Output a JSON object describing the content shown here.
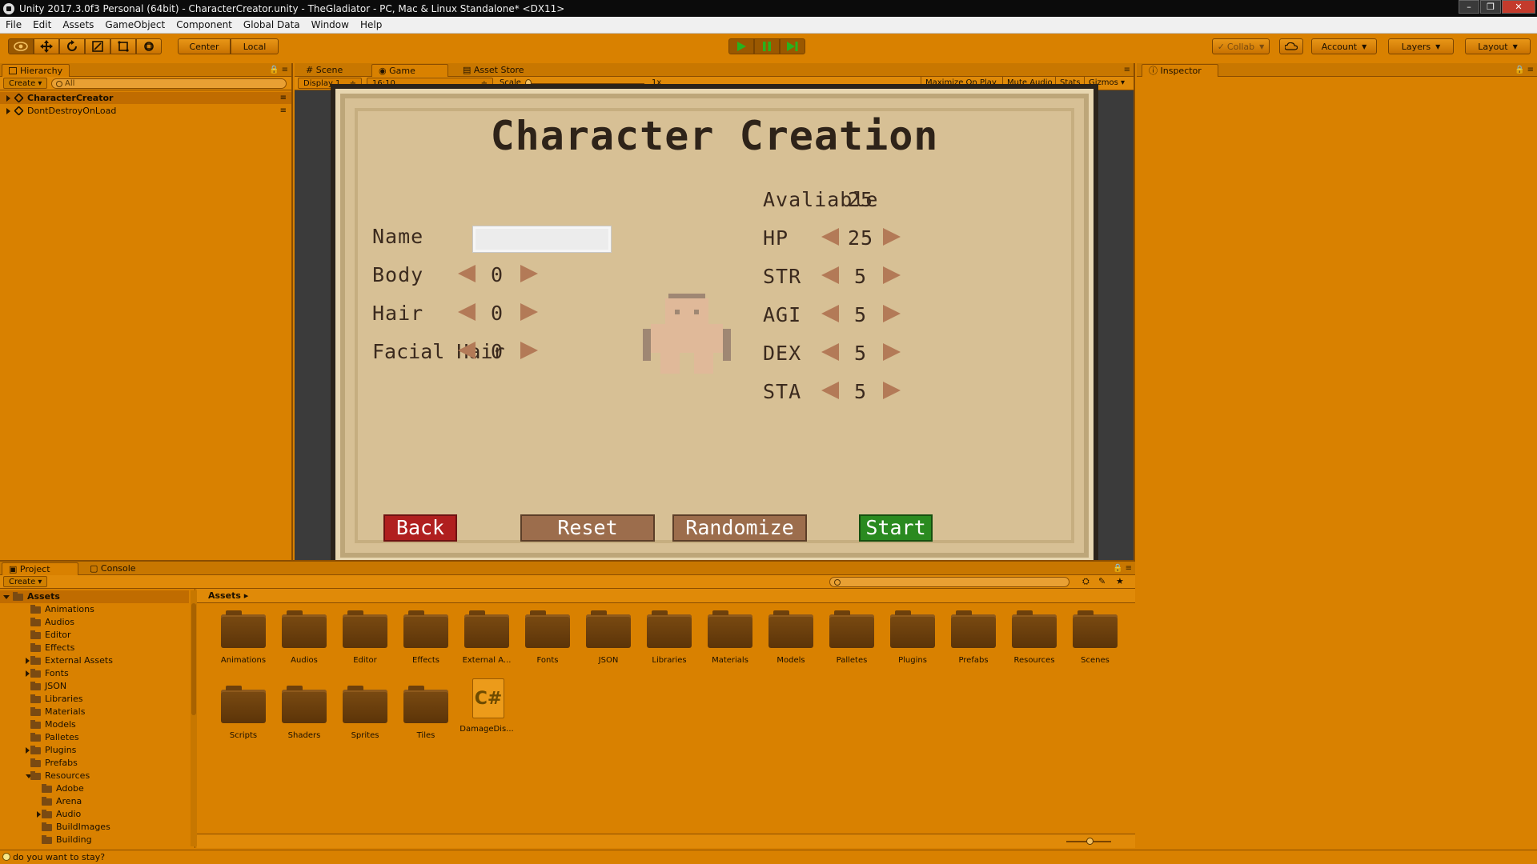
{
  "window": {
    "title": "Unity 2017.3.0f3 Personal (64bit) - CharacterCreator.unity - TheGladiator - PC, Mac & Linux Standalone* <DX11>",
    "controls": [
      "–",
      "❐",
      "✕"
    ]
  },
  "menu": [
    "File",
    "Edit",
    "Assets",
    "GameObject",
    "Component",
    "Global Data",
    "Window",
    "Help"
  ],
  "toolbar": {
    "pivot": "Center",
    "space": "Local",
    "collab": "Collab",
    "account": "Account",
    "layers": "Layers",
    "layout": "Layout",
    "tools": [
      "hand-tool",
      "move-tool",
      "rotate-tool",
      "scale-tool",
      "rect-tool",
      "transform-tool"
    ]
  },
  "hierarchy": {
    "tab": "Hierarchy",
    "create": "Create",
    "search_placeholder": "All",
    "items": [
      "CharacterCreator",
      "DontDestroyOnLoad"
    ]
  },
  "center_tabs": [
    "Scene",
    "Game",
    "Asset Store"
  ],
  "game_toolbar": {
    "display": "Display 1",
    "aspect": "16:10",
    "scale_label": "Scale",
    "scale_value": "1x",
    "maximize": "Maximize On Play",
    "mute": "Mute Audio",
    "stats": "Stats",
    "gizmos": "Gizmos"
  },
  "game": {
    "title": "Character Creation",
    "available_label": "Avaliable",
    "available_value": "25",
    "name_label": "Name",
    "name_value": "",
    "appearance": [
      {
        "label": "Body",
        "value": "0"
      },
      {
        "label": "Hair",
        "value": "0"
      },
      {
        "label": "Facial Hair",
        "value": "0"
      }
    ],
    "stats": [
      {
        "label": "HP",
        "value": "25"
      },
      {
        "label": "STR",
        "value": "5"
      },
      {
        "label": "AGI",
        "value": "5"
      },
      {
        "label": "DEX",
        "value": "5"
      },
      {
        "label": "STA",
        "value": "5"
      }
    ],
    "buttons": {
      "back": "Back",
      "reset": "Reset",
      "randomize": "Randomize",
      "start": "Start"
    },
    "colors": {
      "parchment": "#d7c095",
      "back": "#b01f1f",
      "start": "#2a8a20",
      "neutral": "#9c6d4c",
      "arrow": "#b37a57"
    }
  },
  "inspector": {
    "tab": "Inspector"
  },
  "project": {
    "tabs": [
      "Project",
      "Console"
    ],
    "create": "Create",
    "breadcrumb": "Assets",
    "tree": [
      {
        "label": "Assets",
        "level": 0
      },
      {
        "label": "Animations",
        "level": 1
      },
      {
        "label": "Audios",
        "level": 1
      },
      {
        "label": "Editor",
        "level": 1
      },
      {
        "label": "Effects",
        "level": 1
      },
      {
        "label": "External Assets",
        "level": 1
      },
      {
        "label": "Fonts",
        "level": 1
      },
      {
        "label": "JSON",
        "level": 1
      },
      {
        "label": "Libraries",
        "level": 1
      },
      {
        "label": "Materials",
        "level": 1
      },
      {
        "label": "Models",
        "level": 1
      },
      {
        "label": "Palletes",
        "level": 1
      },
      {
        "label": "Plugins",
        "level": 1
      },
      {
        "label": "Prefabs",
        "level": 1
      },
      {
        "label": "Resources",
        "level": 1
      },
      {
        "label": "Adobe",
        "level": 2
      },
      {
        "label": "Arena",
        "level": 2
      },
      {
        "label": "Audio",
        "level": 2
      },
      {
        "label": "BuildImages",
        "level": 2
      },
      {
        "label": "Building",
        "level": 2
      }
    ],
    "assets": [
      "Animations",
      "Audios",
      "Editor",
      "Effects",
      "External A...",
      "Fonts",
      "JSON",
      "Libraries",
      "Materials",
      "Models",
      "Palletes",
      "Plugins",
      "Prefabs",
      "Resources",
      "Scenes",
      "Scripts",
      "Shaders",
      "Sprites",
      "Tiles"
    ],
    "script_asset": "DamageDis..."
  },
  "status": {
    "message": "do you want to stay?"
  }
}
